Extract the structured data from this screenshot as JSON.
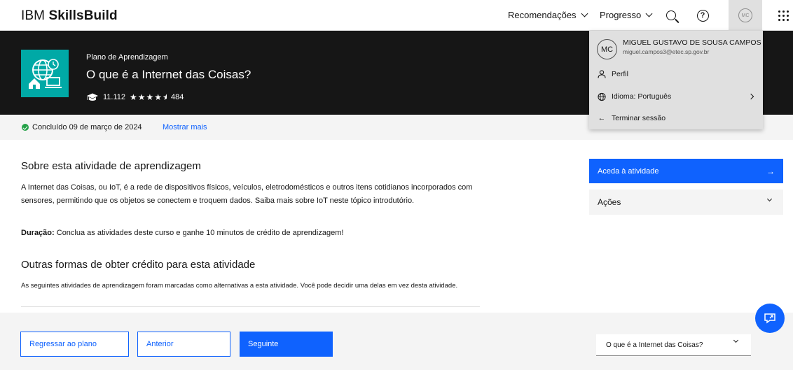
{
  "header": {
    "brand_prefix": "IBM ",
    "brand_bold": "SkillsBuild",
    "nav_recommendations": "Recomendações",
    "nav_progress": "Progresso",
    "avatar_initials": "MC",
    "search_icon": "search-icon",
    "help_icon": "help-icon",
    "apps_icon": "app-switcher-icon"
  },
  "hero": {
    "eyebrow": "Plano de Aprendizagem",
    "title": "O que é a Internet das Coisas?",
    "learners": "11.112",
    "rating_stars": "★★★★",
    "reviews": "484",
    "icon_color": "#00a9a6"
  },
  "status": {
    "completed": "Concluído 09 de março de 2024",
    "show_more": "Mostrar mais"
  },
  "about": {
    "heading": "Sobre esta atividade de aprendizagem",
    "body": "A Internet das Coisas, ou IoT, é a rede de dispositivos físicos, veículos, eletrodomésticos e outros itens cotidianos incorporados com sensores, permitindo que os objetos se conectem e troquem dados. Saiba mais sobre IoT neste tópico introdutório.",
    "duration_label": "Duração:",
    "duration_text": " Conclua as atividades deste curso e ganhe 10 minutos de crédito de aprendizagem!"
  },
  "other": {
    "heading": "Outras formas de obter crédito para esta atividade",
    "body": "As seguintes atividades de aprendizagem foram marcadas como alternativas a esta atividade. Você pode decidir uma delas em vez desta atividade."
  },
  "sidebar": {
    "access_label": "Aceda à atividade",
    "actions_label": "Ações"
  },
  "footer": {
    "back_label": "Regressar ao plano",
    "prev_label": "Anterior",
    "next_label": "Seguinte",
    "select_value": "O que é a Internet das Coisas?"
  },
  "user_menu": {
    "initials": "MC",
    "name": "MIGUEL GUSTAVO DE SOUSA CAMPOS",
    "email": "miguel.campos3@etec.sp.gov.br",
    "profile": "Perfil",
    "language": "Idioma: Português",
    "logout": "Terminar sessão"
  },
  "colors": {
    "primary": "#0f62fe",
    "dark": "#161616",
    "success": "#24a148"
  }
}
